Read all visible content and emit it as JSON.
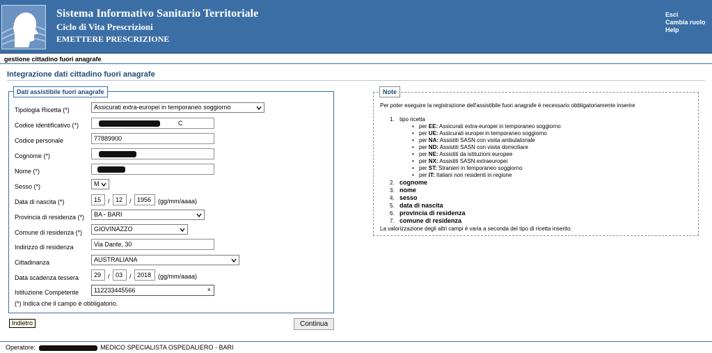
{
  "header": {
    "title": "Sistema Informativo Sanitario Territoriale",
    "subtitle": "Ciclo di Vita Prescrizioni",
    "section": "EMETTERE PRESCRIZIONE",
    "links": {
      "exit": "Esci",
      "change_role": "Cambia ruolo",
      "help": "Help"
    }
  },
  "breadcrumb": "gestione cittadino fuori anagrafe",
  "page_title": "Integrazione dati cittadino fuori anagrafe",
  "form": {
    "legend": "Dati assistibile fuori anagrafe",
    "labels": {
      "tipologia": "Tipologia Ricetta (*)",
      "codice_id": "Codice identificativo (*)",
      "codice_pers": "Codice personale",
      "cognome": "Cognome (*)",
      "nome": "Nome (*)",
      "sesso": "Sesso (*)",
      "nascita": "Data di nascita (*)",
      "provincia": "Provincia di residenza (*)",
      "comune": "Comune di residenza (*)",
      "indirizzo": "Indirizzo di residenza",
      "cittadinanza": "Cittadinanza",
      "scadenza": "Data scadenza tessera",
      "istituzione": "Istituzione Competente"
    },
    "values": {
      "tipologia": "Assicurati extra-europei in temporaneo soggiorno",
      "codice_id_tail": "C",
      "codice_pers": "77889900",
      "sesso": "M",
      "nascita_gg": "15",
      "nascita_mm": "12",
      "nascita_aaaa": "1956",
      "provincia": "BA - BARI",
      "comune": "GIOVINAZZO",
      "indirizzo": "Via Dante, 30",
      "cittadinanza": "AUSTRALIANA",
      "scadenza_gg": "29",
      "scadenza_mm": "03",
      "scadenza_aaaa": "2018",
      "istituzione": "112233445566"
    },
    "date_sep": "/",
    "date_hint": "(gg/mm/aaaa)",
    "required_note": "(*) Indica che il campo è obbligatorio.",
    "clear_glyph": "×"
  },
  "buttons": {
    "back": "Indietro",
    "continue": "Continua"
  },
  "notes": {
    "legend": "Note",
    "intro": "Per poter eseguire la registrazione dell'assistibile fuori anagrafe è necessario obbligatoriamente inserire",
    "items": [
      {
        "num": "1.",
        "label": "tipo ricetta"
      },
      {
        "num": "2.",
        "label": "cognome"
      },
      {
        "num": "3.",
        "label": "nome"
      },
      {
        "num": "4.",
        "label": "sesso"
      },
      {
        "num": "5.",
        "label": "data di nascita"
      },
      {
        "num": "6.",
        "label": "provincia di residenza"
      },
      {
        "num": "7.",
        "label": "comune di residenza"
      }
    ],
    "sub_prefix": "per",
    "subitems": [
      {
        "code": "EE:",
        "text": "Assicurati extra-europei in temporaneo soggiorno"
      },
      {
        "code": "UE:",
        "text": "Assicurati europei in temporaneo soggiorno"
      },
      {
        "code": "NA:",
        "text": "Assistiti SASN con visita ambulatoriale"
      },
      {
        "code": "ND:",
        "text": "Assistiti SASN con visita domiciliare"
      },
      {
        "code": "NE:",
        "text": "Assistiti da istituzioni europee"
      },
      {
        "code": "NX:",
        "text": "Assistiti SASN extraeuropei"
      },
      {
        "code": "ST:",
        "text": "Stranieri in temporaneo soggiorno"
      },
      {
        "code": "IT:",
        "text": "Italiani non residenti in regione"
      }
    ],
    "outro": "La valorizzazione degli altri campi è varia a seconda del tipo di ricetta inserito."
  },
  "footer": {
    "label": "Operatore:",
    "role": "MEDICO SPECIALISTA OSPEDALIERO - BARI"
  },
  "colors": {
    "header_bg": "#3a6ea5",
    "title_blue": "#1f4a78"
  }
}
